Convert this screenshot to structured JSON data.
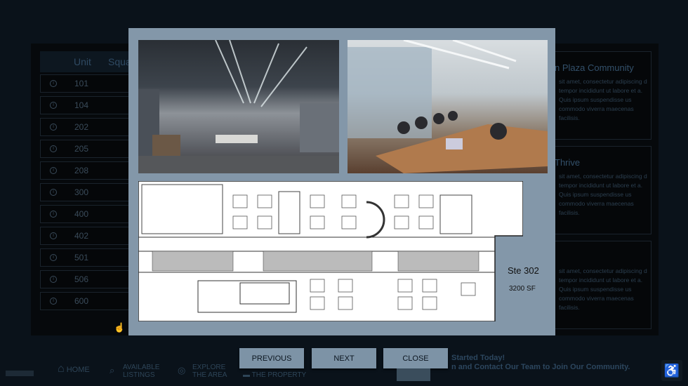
{
  "table": {
    "headers": [
      "Unit",
      "Squa"
    ],
    "units": [
      "101",
      "104",
      "202",
      "205",
      "208",
      "300",
      "400",
      "402",
      "501",
      "506",
      "600"
    ]
  },
  "cards": [
    {
      "title": "n Plaza Community",
      "body": "sit amet, consectetur adipiscing d tempor incididunt ut labore et a. Quis ipsum suspendisse us commodo viverra maecenas facilisis."
    },
    {
      "title": "Thrive",
      "body": "sit amet, consectetur adipiscing d tempor incididunt ut labore et a. Quis ipsum suspendisse us commodo viverra maecenas facilisis."
    },
    {
      "title": "",
      "body": "sit amet, consectetur adipiscing d tempor incididunt ut labore et a. Quis ipsum suspendisse us commodo viverra maecenas facilisis."
    }
  ],
  "partial_link": "S",
  "modal": {
    "suite": "Ste 302",
    "area": "3200 SF",
    "previous": "PREVIOUS",
    "next": "NEXT",
    "close": "CLOSE"
  },
  "nav": {
    "home": "HOME",
    "listings1": "AVAILABLE",
    "listings2": "LISTINGS",
    "explore1": "EXPLORE",
    "explore2": "THE AREA",
    "property": "THE PROPERTY"
  },
  "footer": {
    "line1": "Started Today!",
    "line2": "n and Contact Our Team to Join Our Community."
  },
  "colors": {
    "modal": "#8397a9",
    "button": "#7d93a6",
    "background": "#0a121a"
  }
}
